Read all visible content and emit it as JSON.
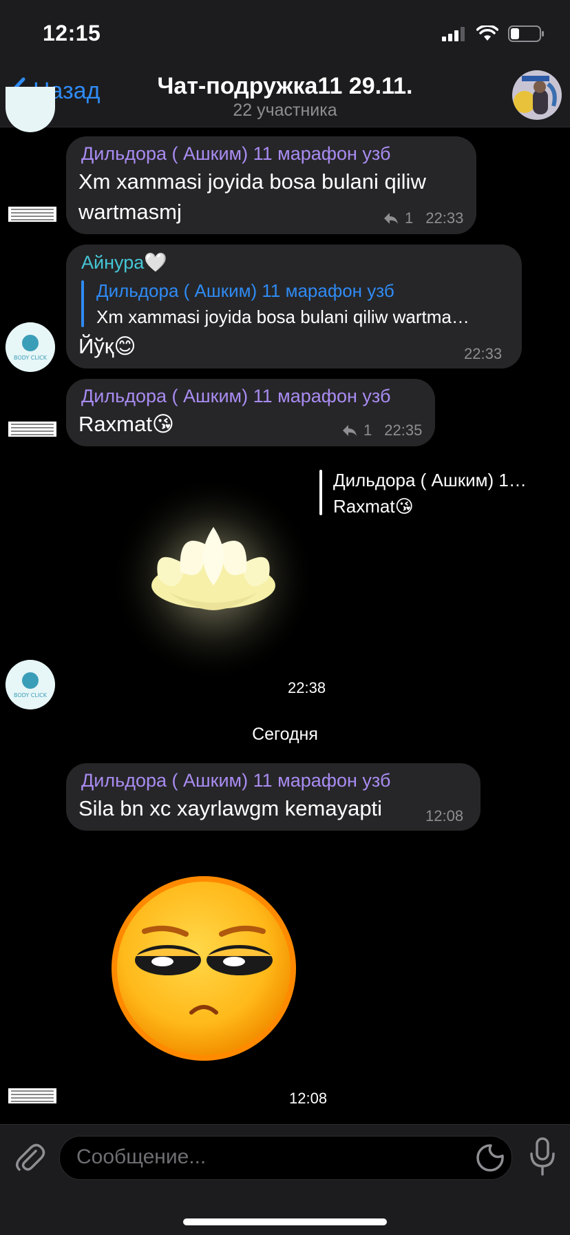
{
  "status": {
    "time": "12:15"
  },
  "header": {
    "back_label": "Назад",
    "title": "Чат-подружка11 29.11.",
    "subtitle": "22 участника"
  },
  "messages": [
    {
      "sender": "Дильдора ( Ашким) 11 марафон узб",
      "line1": "Xm xammasi joyida bosa bulani qiliw",
      "line2": "wartmasmj",
      "replies": "1",
      "time": "22:33"
    },
    {
      "sender": "Айнура🤍",
      "reply_name": "Дильдора ( Ашким) 11 марафон узб",
      "reply_text": "Xm xammasi joyida bosa bulani qiliw wartma…",
      "text": "Йўқ😊",
      "time": "22:33"
    },
    {
      "sender": "Дильдора ( Ашким) 11 марафон узб",
      "text": "Raxmat😘",
      "replies": "1",
      "time": "22:35"
    },
    {
      "reply_name": "Дильдора ( Ашким) 1…",
      "reply_text": "Raxmat😘",
      "time": "22:38"
    },
    {
      "sender": "Дильдора ( Ашким) 11 марафон узб",
      "text": "Sila bn xc xayrlawgm kemayapti",
      "time": "12:08"
    },
    {
      "time": "12:08"
    }
  ],
  "date_separator": "Сегодня",
  "input": {
    "placeholder": "Сообщение..."
  },
  "icons": [
    "chevron-left-icon",
    "attach-icon",
    "sticker-icon",
    "microphone-icon",
    "signal-icon",
    "wifi-icon",
    "battery-icon"
  ],
  "colors": {
    "accent": "#2f8bf5",
    "sender_purple": "#a98cf2",
    "sender_teal": "#45c6d6",
    "bubble": "#262628"
  }
}
